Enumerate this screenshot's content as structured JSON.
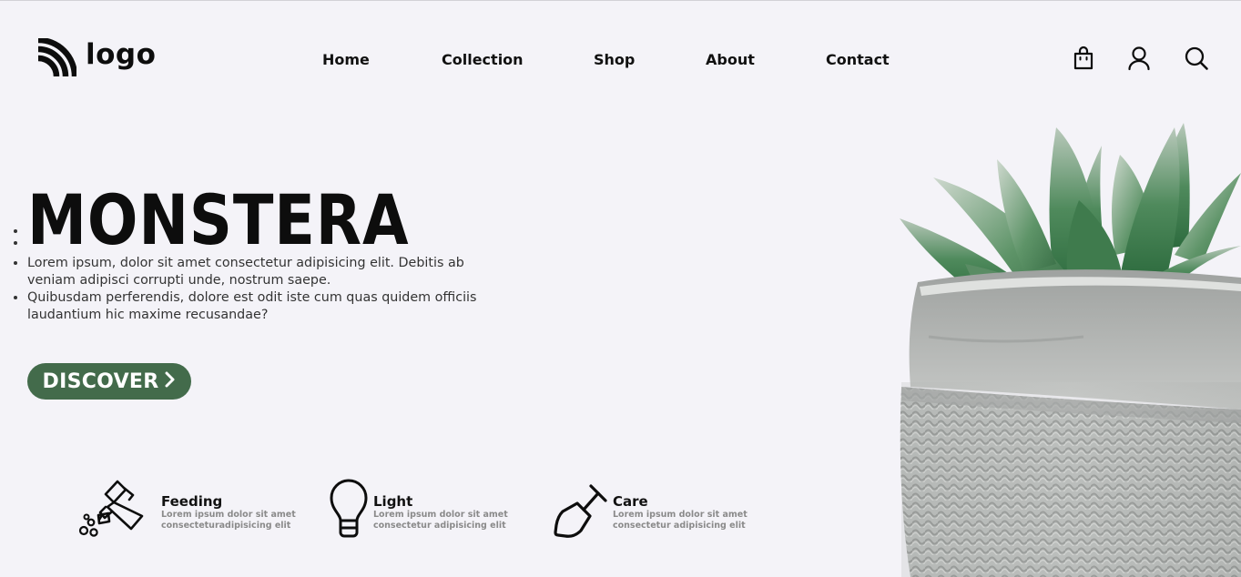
{
  "header": {
    "logo_text": "logo",
    "nav": [
      "Home",
      "Collection",
      "Shop",
      "About",
      "Contact"
    ],
    "icons": [
      "shopping-bag-icon",
      "user-icon",
      "search-icon"
    ]
  },
  "hero": {
    "title": "MONSTERA",
    "paragraphs": [
      "Lorem ipsum, dolor sit amet consectetur adipisicing elit. Debitis ab veniam adipisci corrupti unde, nostrum saepe.",
      "Quibusdam perferendis, dolore est odit iste cum quas quidem officiis laudantium hic maxime recusandae?"
    ],
    "cta_label": "DISCOVER"
  },
  "features": [
    {
      "title": "Feeding",
      "desc_lines": [
        "Lorem ipsum dolor sit amet",
        "consecteturadipisicing elit"
      ],
      "icon": "watering-can-icon"
    },
    {
      "title": "Light",
      "desc_lines": [
        "Lorem ipsum dolor sit amet",
        "consectetur adipisicing elit"
      ],
      "icon": "lightbulb-icon"
    },
    {
      "title": "Care",
      "desc_lines": [
        "Lorem ipsum dolor sit amet",
        "consectetur adipisicing elit"
      ],
      "icon": "shovel-icon"
    }
  ],
  "colors": {
    "background": "#f4f3f8",
    "accent": "#436b4b",
    "text": "#111111",
    "muted": "#8a8a8a"
  }
}
